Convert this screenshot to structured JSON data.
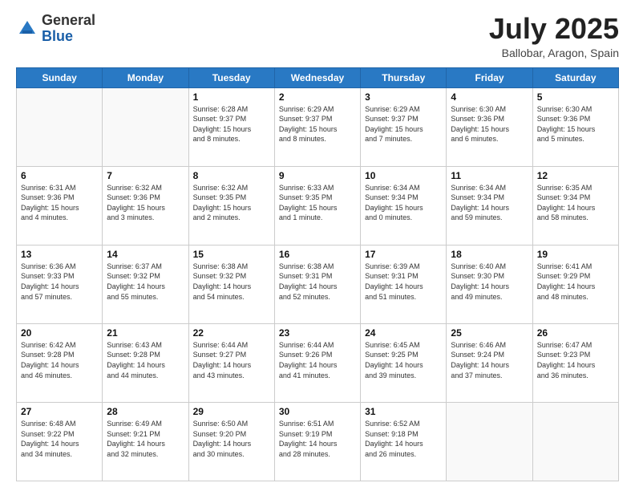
{
  "header": {
    "logo_general": "General",
    "logo_blue": "Blue",
    "month_title": "July 2025",
    "location": "Ballobar, Aragon, Spain"
  },
  "weekdays": [
    "Sunday",
    "Monday",
    "Tuesday",
    "Wednesday",
    "Thursday",
    "Friday",
    "Saturday"
  ],
  "weeks": [
    [
      {
        "day": "",
        "detail": ""
      },
      {
        "day": "",
        "detail": ""
      },
      {
        "day": "1",
        "detail": "Sunrise: 6:28 AM\nSunset: 9:37 PM\nDaylight: 15 hours\nand 8 minutes."
      },
      {
        "day": "2",
        "detail": "Sunrise: 6:29 AM\nSunset: 9:37 PM\nDaylight: 15 hours\nand 8 minutes."
      },
      {
        "day": "3",
        "detail": "Sunrise: 6:29 AM\nSunset: 9:37 PM\nDaylight: 15 hours\nand 7 minutes."
      },
      {
        "day": "4",
        "detail": "Sunrise: 6:30 AM\nSunset: 9:36 PM\nDaylight: 15 hours\nand 6 minutes."
      },
      {
        "day": "5",
        "detail": "Sunrise: 6:30 AM\nSunset: 9:36 PM\nDaylight: 15 hours\nand 5 minutes."
      }
    ],
    [
      {
        "day": "6",
        "detail": "Sunrise: 6:31 AM\nSunset: 9:36 PM\nDaylight: 15 hours\nand 4 minutes."
      },
      {
        "day": "7",
        "detail": "Sunrise: 6:32 AM\nSunset: 9:36 PM\nDaylight: 15 hours\nand 3 minutes."
      },
      {
        "day": "8",
        "detail": "Sunrise: 6:32 AM\nSunset: 9:35 PM\nDaylight: 15 hours\nand 2 minutes."
      },
      {
        "day": "9",
        "detail": "Sunrise: 6:33 AM\nSunset: 9:35 PM\nDaylight: 15 hours\nand 1 minute."
      },
      {
        "day": "10",
        "detail": "Sunrise: 6:34 AM\nSunset: 9:34 PM\nDaylight: 15 hours\nand 0 minutes."
      },
      {
        "day": "11",
        "detail": "Sunrise: 6:34 AM\nSunset: 9:34 PM\nDaylight: 14 hours\nand 59 minutes."
      },
      {
        "day": "12",
        "detail": "Sunrise: 6:35 AM\nSunset: 9:34 PM\nDaylight: 14 hours\nand 58 minutes."
      }
    ],
    [
      {
        "day": "13",
        "detail": "Sunrise: 6:36 AM\nSunset: 9:33 PM\nDaylight: 14 hours\nand 57 minutes."
      },
      {
        "day": "14",
        "detail": "Sunrise: 6:37 AM\nSunset: 9:32 PM\nDaylight: 14 hours\nand 55 minutes."
      },
      {
        "day": "15",
        "detail": "Sunrise: 6:38 AM\nSunset: 9:32 PM\nDaylight: 14 hours\nand 54 minutes."
      },
      {
        "day": "16",
        "detail": "Sunrise: 6:38 AM\nSunset: 9:31 PM\nDaylight: 14 hours\nand 52 minutes."
      },
      {
        "day": "17",
        "detail": "Sunrise: 6:39 AM\nSunset: 9:31 PM\nDaylight: 14 hours\nand 51 minutes."
      },
      {
        "day": "18",
        "detail": "Sunrise: 6:40 AM\nSunset: 9:30 PM\nDaylight: 14 hours\nand 49 minutes."
      },
      {
        "day": "19",
        "detail": "Sunrise: 6:41 AM\nSunset: 9:29 PM\nDaylight: 14 hours\nand 48 minutes."
      }
    ],
    [
      {
        "day": "20",
        "detail": "Sunrise: 6:42 AM\nSunset: 9:28 PM\nDaylight: 14 hours\nand 46 minutes."
      },
      {
        "day": "21",
        "detail": "Sunrise: 6:43 AM\nSunset: 9:28 PM\nDaylight: 14 hours\nand 44 minutes."
      },
      {
        "day": "22",
        "detail": "Sunrise: 6:44 AM\nSunset: 9:27 PM\nDaylight: 14 hours\nand 43 minutes."
      },
      {
        "day": "23",
        "detail": "Sunrise: 6:44 AM\nSunset: 9:26 PM\nDaylight: 14 hours\nand 41 minutes."
      },
      {
        "day": "24",
        "detail": "Sunrise: 6:45 AM\nSunset: 9:25 PM\nDaylight: 14 hours\nand 39 minutes."
      },
      {
        "day": "25",
        "detail": "Sunrise: 6:46 AM\nSunset: 9:24 PM\nDaylight: 14 hours\nand 37 minutes."
      },
      {
        "day": "26",
        "detail": "Sunrise: 6:47 AM\nSunset: 9:23 PM\nDaylight: 14 hours\nand 36 minutes."
      }
    ],
    [
      {
        "day": "27",
        "detail": "Sunrise: 6:48 AM\nSunset: 9:22 PM\nDaylight: 14 hours\nand 34 minutes."
      },
      {
        "day": "28",
        "detail": "Sunrise: 6:49 AM\nSunset: 9:21 PM\nDaylight: 14 hours\nand 32 minutes."
      },
      {
        "day": "29",
        "detail": "Sunrise: 6:50 AM\nSunset: 9:20 PM\nDaylight: 14 hours\nand 30 minutes."
      },
      {
        "day": "30",
        "detail": "Sunrise: 6:51 AM\nSunset: 9:19 PM\nDaylight: 14 hours\nand 28 minutes."
      },
      {
        "day": "31",
        "detail": "Sunrise: 6:52 AM\nSunset: 9:18 PM\nDaylight: 14 hours\nand 26 minutes."
      },
      {
        "day": "",
        "detail": ""
      },
      {
        "day": "",
        "detail": ""
      }
    ]
  ]
}
